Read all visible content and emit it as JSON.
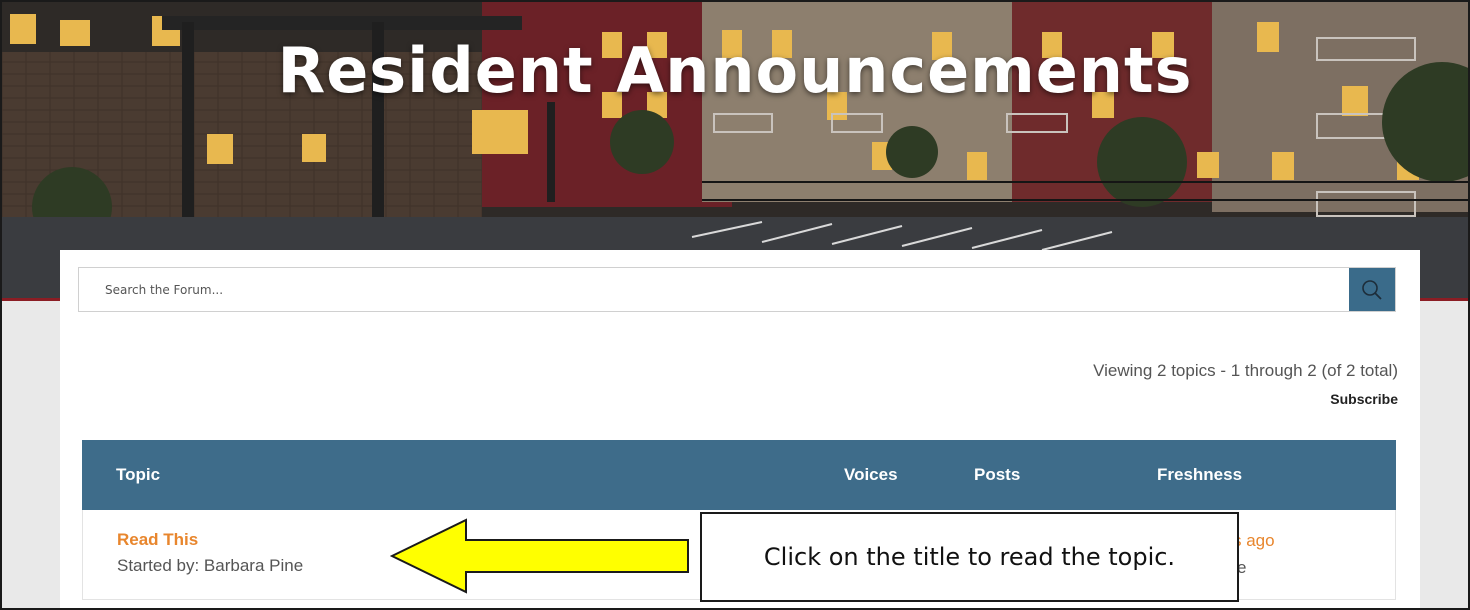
{
  "hero": {
    "title": "Resident Announcements"
  },
  "search": {
    "placeholder": "Search the Forum..."
  },
  "icons": {
    "search_button": "search-icon"
  },
  "colors": {
    "header_bg": "#3e6c8a",
    "link": "#e8862d",
    "search_button": "#3a6b8a",
    "callout_arrow": "#ffff00"
  },
  "topics": {
    "viewing_text": "Viewing 2 topics - 1 through 2 (of 2 total)",
    "subscribe_label": "Subscribe",
    "columns": {
      "topic": "Topic",
      "voices": "Voices",
      "posts": "Posts",
      "freshness": "Freshness"
    },
    "rows": [
      {
        "title": "Read This",
        "started_by": "Started by:  Barbara Pine",
        "freshness": "s ago",
        "freshness_author": "e"
      }
    ]
  },
  "annotation": {
    "callout_text": "Click on the title to read the topic."
  }
}
